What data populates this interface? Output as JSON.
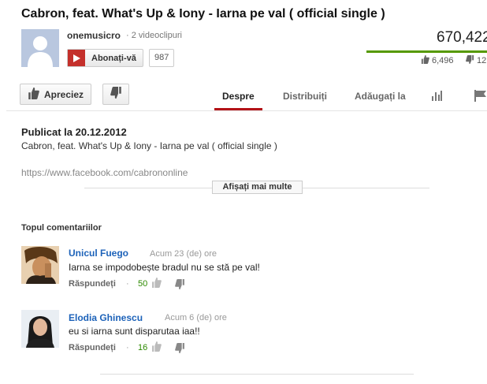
{
  "video": {
    "title": "Cabron, feat. What's Up & Iony - Iarna pe val ( official single )",
    "views": "670,422",
    "likes": "6,496",
    "dislikes": "12"
  },
  "channel": {
    "name": "onemusicro",
    "meta": "· 2 videoclipuri",
    "subscribe_label": "Abonați-vă",
    "subscriber_count": "987"
  },
  "actions": {
    "like_label": "Apreciez"
  },
  "tabs": [
    {
      "label": "Despre"
    },
    {
      "label": "Distribuiți"
    },
    {
      "label": "Adăugați la"
    }
  ],
  "description": {
    "published": "Publicat la 20.12.2012",
    "text": "Cabron, feat. What's Up & Iony - Iarna pe val ( official single )",
    "link": "https://www.facebook.com/cabrononline",
    "show_more": "Afișați mai multe"
  },
  "comments": {
    "title": "Topul comentariilor",
    "items": [
      {
        "author": "Unicul Fuego",
        "time": "Acum 23 (de) ore",
        "text": "Iarna se impodobește bradul nu se stă pe val!",
        "reply": "Răspundeți",
        "dot": "·",
        "votes": "50"
      },
      {
        "author": "Elodia Ghinescu",
        "time": "Acum 6 (de) ore",
        "text": "eu si iarna sunt disparutaa iaa!!",
        "reply": "Răspundeți",
        "dot": "·",
        "votes": "16"
      }
    ]
  },
  "colors": {
    "accent": "#b31217",
    "link": "#1c62b9",
    "like_bar": "#559900",
    "vote_count": "#2d8a00"
  },
  "like_ratio": 0.998
}
